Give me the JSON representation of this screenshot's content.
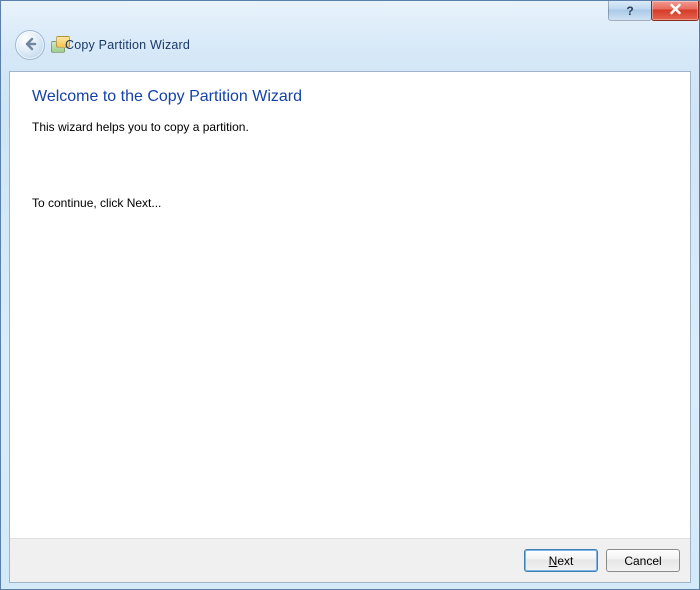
{
  "window": {
    "title": "Copy Partition Wizard"
  },
  "titlebar": {
    "help_label": "?",
    "close_label": "Close"
  },
  "header": {
    "back_label": "Back",
    "app_icon": "partition-copy-icon",
    "title": "Copy Partition Wizard"
  },
  "page": {
    "heading": "Welcome to the Copy Partition Wizard",
    "intro": "This wizard helps you to copy a partition.",
    "continue_hint": "To continue, click Next..."
  },
  "buttons": {
    "next_prefix": "N",
    "next_rest": "ext",
    "cancel": "Cancel"
  }
}
